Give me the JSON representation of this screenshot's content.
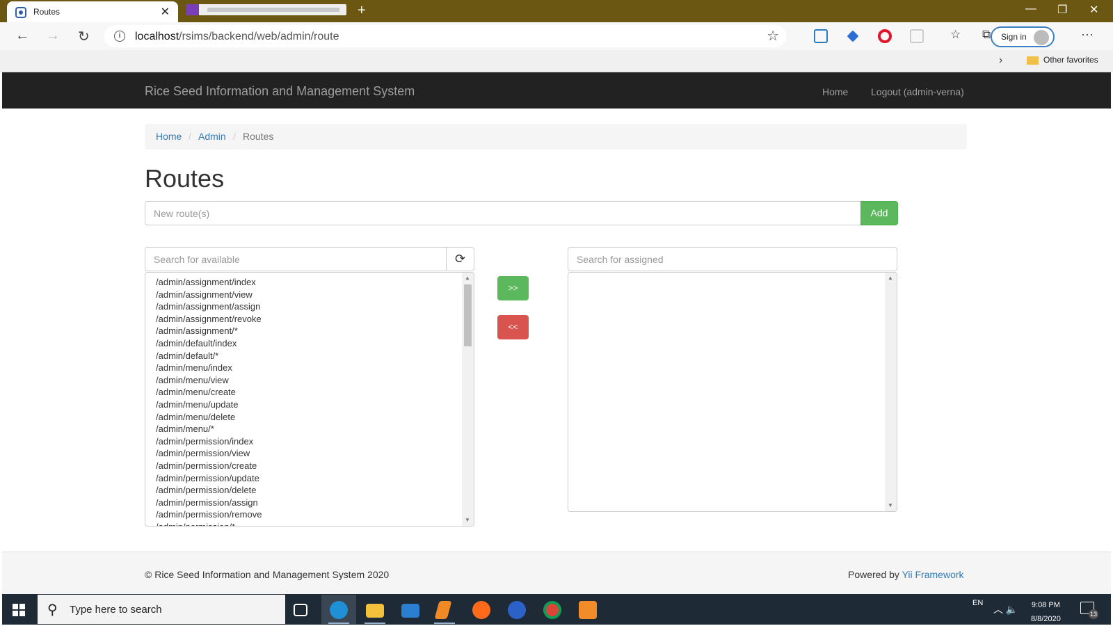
{
  "browser": {
    "tab_title": "Routes",
    "tab_close": "✕",
    "new_tab": "+",
    "url_host": "localhost",
    "url_path": "/rsims/backend/web/admin/route",
    "sign_in": "Sign in",
    "other_favorites": "Other favorites"
  },
  "nav": {
    "brand": "Rice Seed Information and Management System",
    "home": "Home",
    "logout": "Logout (admin-verna)"
  },
  "breadcrumb": {
    "home": "Home",
    "admin": "Admin",
    "current": "Routes",
    "separator": "/"
  },
  "page": {
    "title": "Routes",
    "new_route_placeholder": "New route(s)",
    "add_label": "Add",
    "search_available_placeholder": "Search for available",
    "search_assigned_placeholder": "Search for assigned",
    "assign_label": ">>",
    "remove_label": "<<",
    "available_routes": [
      "/admin/assignment/index",
      "/admin/assignment/view",
      "/admin/assignment/assign",
      "/admin/assignment/revoke",
      "/admin/assignment/*",
      "/admin/default/index",
      "/admin/default/*",
      "/admin/menu/index",
      "/admin/menu/view",
      "/admin/menu/create",
      "/admin/menu/update",
      "/admin/menu/delete",
      "/admin/menu/*",
      "/admin/permission/index",
      "/admin/permission/view",
      "/admin/permission/create",
      "/admin/permission/update",
      "/admin/permission/delete",
      "/admin/permission/assign",
      "/admin/permission/remove",
      "/admin/permission/*"
    ],
    "assigned_routes": []
  },
  "footer": {
    "copyright": "© Rice Seed Information and Management System 2020",
    "powered_by": "Powered by",
    "framework": "Yii Framework"
  },
  "taskbar": {
    "search_placeholder": "Type here to search",
    "language": "EN",
    "time": "9:08 PM",
    "date": "8/8/2020",
    "notification_count": "13"
  },
  "colors": {
    "titlebar": "#6b5712",
    "navbar": "#222222",
    "add_button": "#5cb85c",
    "assign_button": "#5cb85c",
    "remove_button": "#d9534f",
    "link": "#337ab7"
  }
}
